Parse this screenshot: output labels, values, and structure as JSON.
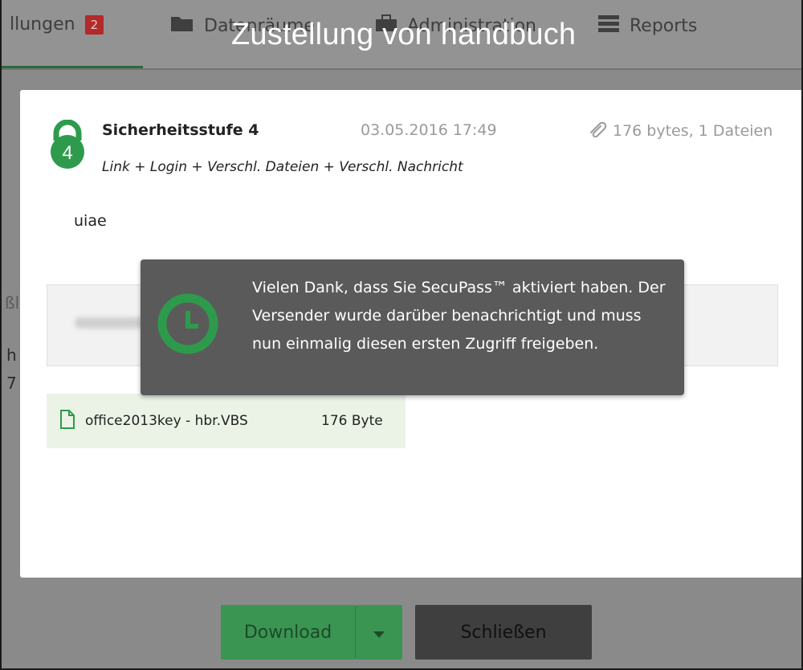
{
  "nav": {
    "items": [
      {
        "label": "llungen",
        "badge": "2"
      },
      {
        "label": "Datenräume"
      },
      {
        "label": "Administration"
      },
      {
        "label": "Reports"
      }
    ]
  },
  "background": {
    "fragment_1": "h",
    "fragment_2": "7",
    "fragment_3": "ßl"
  },
  "modal": {
    "title": "Zustellung von handbuch",
    "security_level_number": "4",
    "security_level_title": "Sicherheitsstufe 4",
    "date": "03.05.2016 17:49",
    "size_summary": "176 bytes, 1 Dateien",
    "security_description": "Link + Login + Verschl. Dateien + Verschl. Nachricht",
    "message": "uiae",
    "file": {
      "name": "office2013key - hbr.VBS",
      "size": "176 Byte"
    }
  },
  "toast": {
    "text": "Vielen Dank, dass Sie SecuPass™ aktiviert haben. Der Versender wurde darüber benachrichtigt und muss nun einmalig diesen ersten Zugriff freigeben."
  },
  "buttons": {
    "download": "Download",
    "close": "Schließen"
  },
  "colors": {
    "accent_green": "#2e9a4c",
    "badge_red": "#b22a2a",
    "toast_bg": "#5a5a5a"
  },
  "icons": [
    "folder-icon",
    "briefcase-icon",
    "reports-icon",
    "lock-icon",
    "paperclip-icon",
    "file-icon",
    "clock-icon",
    "caret-down-icon"
  ]
}
